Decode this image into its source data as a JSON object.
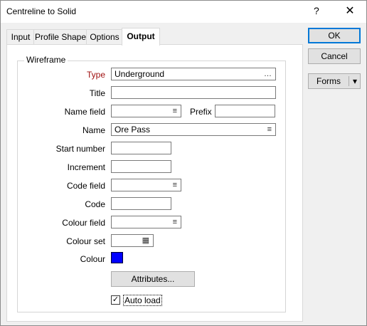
{
  "window": {
    "title": "Centreline to Solid",
    "help": "?",
    "close": "✕"
  },
  "tabs": [
    {
      "label": "Input"
    },
    {
      "label": "Profile Shape"
    },
    {
      "label": "Options"
    },
    {
      "label": "Output"
    }
  ],
  "group": {
    "legend": "Wireframe"
  },
  "form": {
    "type": {
      "label": "Type",
      "value": "Underground"
    },
    "title": {
      "label": "Title",
      "value": ""
    },
    "name_field": {
      "label": "Name field",
      "value": ""
    },
    "prefix": {
      "label": "Prefix",
      "value": ""
    },
    "name": {
      "label": "Name",
      "value": "Ore Pass"
    },
    "start_number": {
      "label": "Start number",
      "value": ""
    },
    "increment": {
      "label": "Increment",
      "value": ""
    },
    "code_field": {
      "label": "Code field",
      "value": ""
    },
    "code": {
      "label": "Code",
      "value": ""
    },
    "colour_field": {
      "label": "Colour field",
      "value": ""
    },
    "colour_set": {
      "label": "Colour set",
      "value": ""
    },
    "colour": {
      "label": "Colour",
      "value": "#0000ff"
    },
    "attributes_button": "Attributes...",
    "auto_load": {
      "label": "Auto load",
      "checked": true,
      "mark": "✓"
    }
  },
  "buttons": {
    "ok": "OK",
    "cancel": "Cancel",
    "forms": "Forms",
    "forms_arrow": "▾"
  },
  "icons": {
    "list": "≡",
    "browse": "…",
    "colour_set": "▦"
  }
}
